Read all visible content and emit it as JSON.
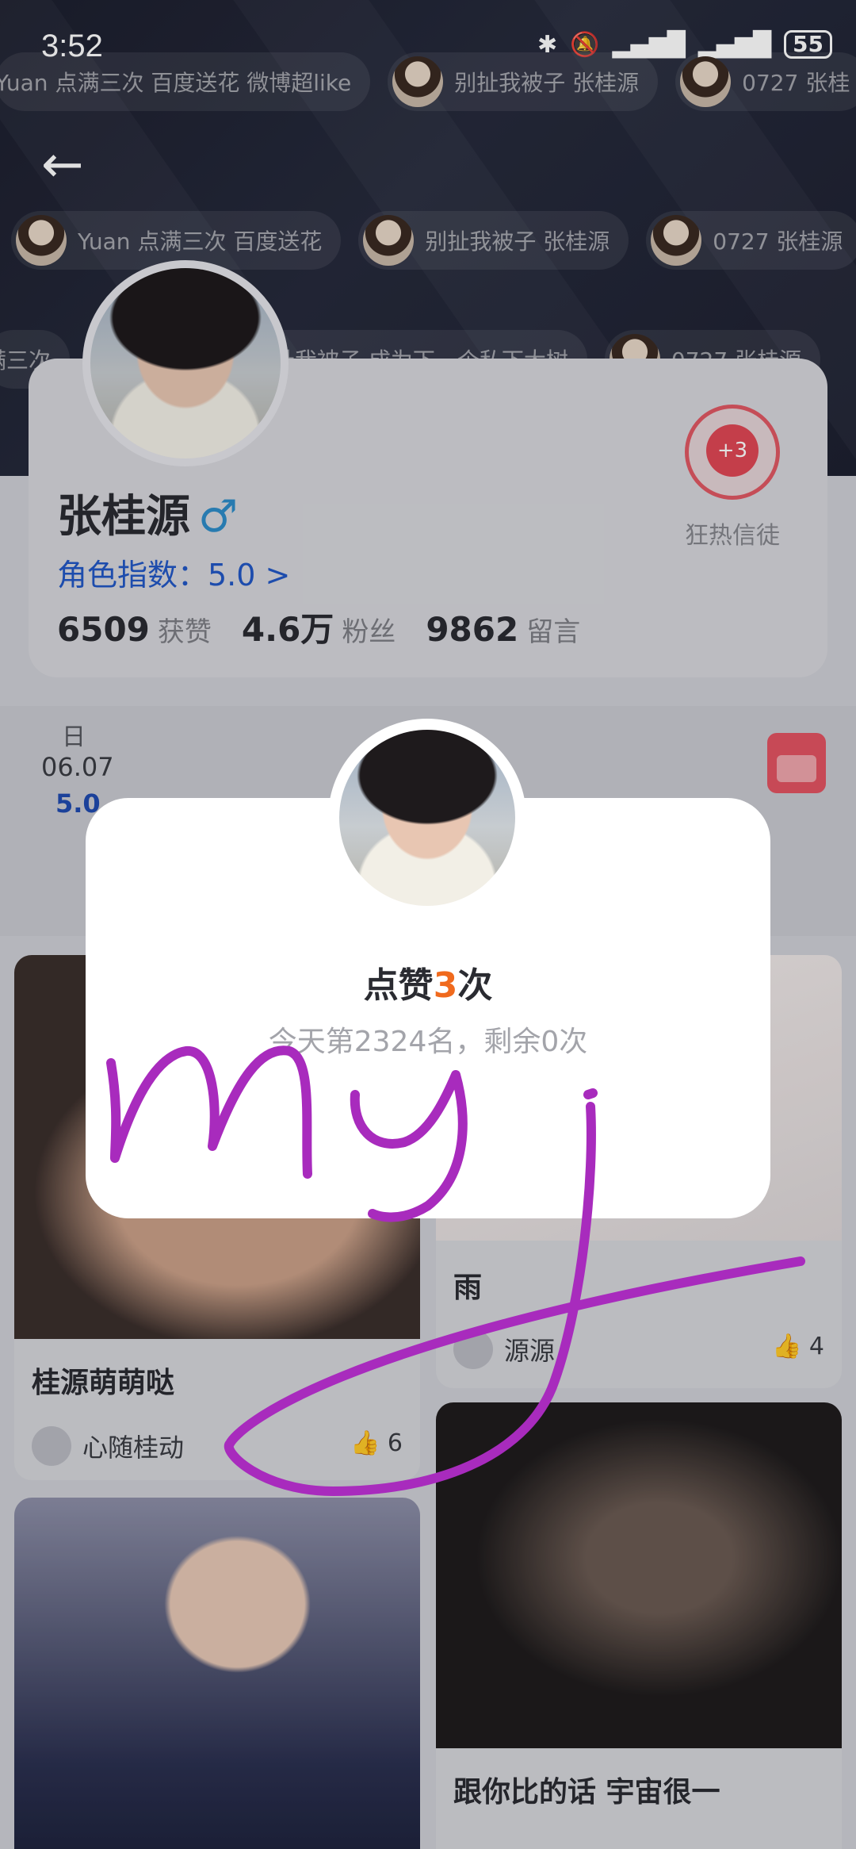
{
  "status_bar": {
    "time": "3:52",
    "battery": "55",
    "icons": [
      "bluetooth-icon",
      "vibrate-icon",
      "mute-icon",
      "signal-icon",
      "signal-icon",
      "battery-icon"
    ]
  },
  "danmu": {
    "row1": [
      "Yuan 点满三次 百度送花 微博超like",
      "别扯我被子 张桂源",
      "0727 张桂"
    ],
    "row2": [
      "Yuan 点满三次 百度送花",
      "别扯我被子 张桂源",
      "0727 张桂源"
    ],
    "row3": [
      "满三次",
      "别扯我被子 成为下一个私下大树",
      "0727 张桂源"
    ]
  },
  "profile": {
    "name": "张桂源",
    "gender_symbol": "♂",
    "role_index": "角色指数：5.0 >",
    "likes_value": "6509",
    "likes_label": "获赞",
    "fans_value": "4.6万",
    "fans_label": "粉丝",
    "comments_value": "9862",
    "comments_label": "留言",
    "fan_badge": "+3",
    "fan_label": "狂热信徒"
  },
  "date_panel": {
    "weekday": "日",
    "date": "06.07",
    "score": "5.0"
  },
  "posts": [
    {
      "title": "桂源萌萌哒",
      "user": "心随桂动",
      "likes": "6"
    },
    {
      "title": "雨",
      "user": "源源",
      "likes": "4"
    },
    {
      "title": "跟你比的话 宇宙很一",
      "user": "",
      "likes": ""
    },
    {
      "title": "",
      "user": "",
      "likes": ""
    }
  ],
  "dialog": {
    "title_prefix": "点赞",
    "title_count": "3",
    "title_suffix": "次",
    "subtitle": "今天第2324名，剩余0次"
  },
  "colors": {
    "accent_blue": "#2157c5",
    "accent_red": "#e04755",
    "accent_orange": "#f06a1d",
    "scribble_purple": "#a82bbd"
  }
}
